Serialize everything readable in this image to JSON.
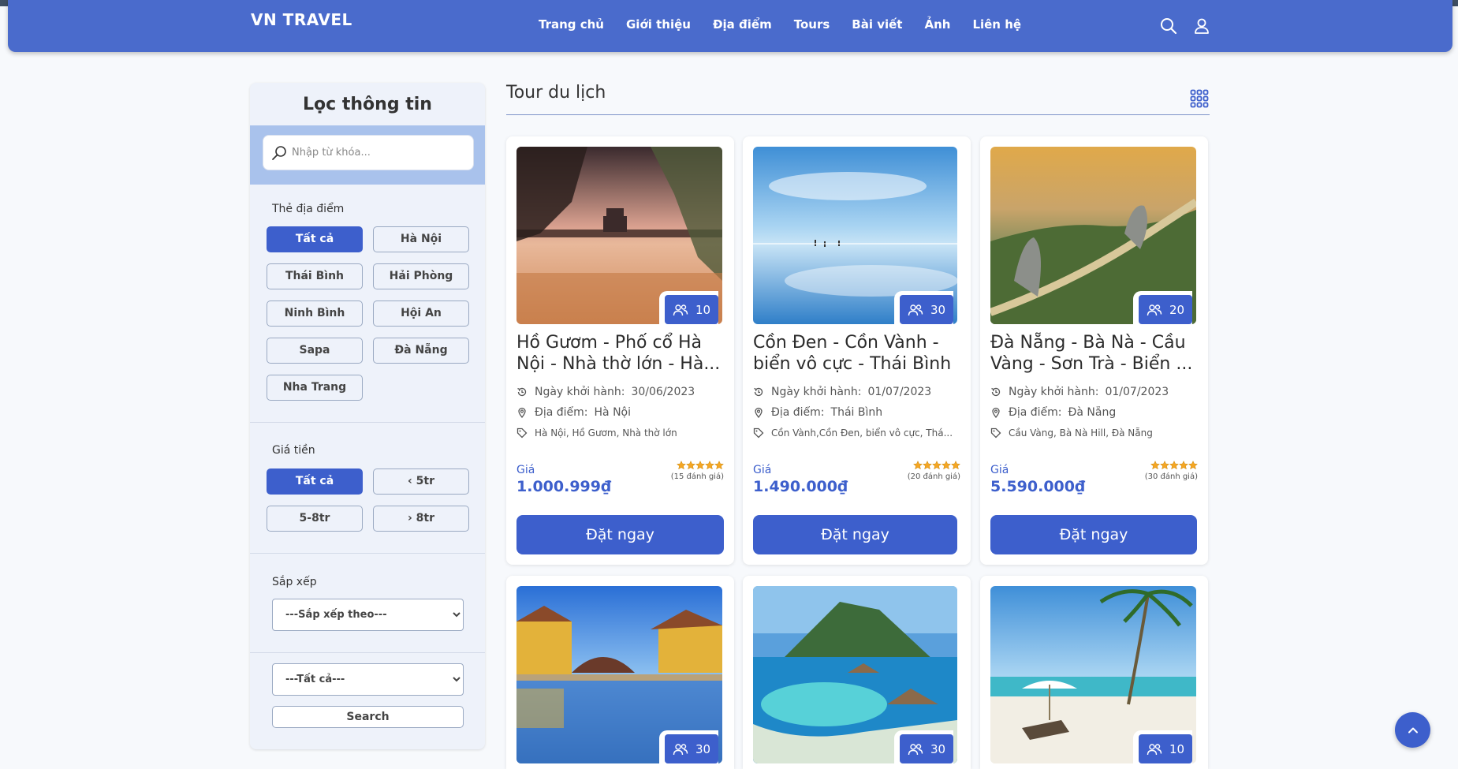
{
  "header": {
    "brand": "VN TRAVEL",
    "nav": [
      "Trang chủ",
      "Giới thiệu",
      "Địa điểm",
      "Tours",
      "Bài viết",
      "Ảnh",
      "Liên hệ"
    ]
  },
  "sidebar": {
    "title": "Lọc thông tin",
    "search_placeholder": "Nhập từ khóa...",
    "location_label": "Thẻ địa điểm",
    "locations": [
      "Tất cả",
      "Hà Nội",
      "Thái Bình",
      "Hải Phòng",
      "Ninh Bình",
      "Hội An",
      "Sapa",
      "Đà Nẵng",
      "Nha Trang"
    ],
    "price_label": "Giá tiền",
    "prices": [
      "Tất cả",
      "5tr",
      "5-8tr",
      "8tr"
    ],
    "sort_label": "Sắp xếp",
    "sort_selected": "---Sắp xếp theo---",
    "filter_selected": "---Tất cả---",
    "search_button": "Search"
  },
  "main": {
    "title": "Tour du lịch",
    "date_label": "Ngày khởi hành:",
    "place_label": "Địa điểm:",
    "price_label": "Giá",
    "book_label": "Đặt ngay"
  },
  "tours": [
    {
      "name": "Hồ Gươm - Phố cổ Hà Nội - Nhà thờ lớn - Hà...",
      "slots": "10",
      "date": "30/06/2023",
      "place": "Hà Nội",
      "tags": "Hà Nội, Hồ Gươm, Nhà thờ lớn",
      "price": "1.000.999₫",
      "rating": 5,
      "reviews": "(15 đánh giá)"
    },
    {
      "name": "Cồn Đen - Cồn Vành - biển vô cực - Thái Bình",
      "slots": "30",
      "date": "01/07/2023",
      "place": "Thái Bình",
      "tags": "Cồn Vành,Cồn Đen, biển vô cực, Thá...",
      "price": "1.490.000₫",
      "rating": 5,
      "reviews": "(20 đánh giá)"
    },
    {
      "name": "Đà Nẵng - Bà Nà - Cầu Vàng - Sơn Trà - Biển ...",
      "slots": "20",
      "date": "01/07/2023",
      "place": "Đà Nẵng",
      "tags": "Cầu Vàng, Bà Nà Hill, Đà Nẵng",
      "price": "5.590.000₫",
      "rating": 5,
      "reviews": "(30 đánh giá)"
    },
    {
      "slots": "30"
    },
    {
      "slots": "30"
    },
    {
      "slots": "10"
    }
  ],
  "colors": {
    "primary": "#3d5fcc",
    "header": "#4a6bcc",
    "sidebar_bg": "#eef2fa",
    "star": "#f5a623"
  }
}
